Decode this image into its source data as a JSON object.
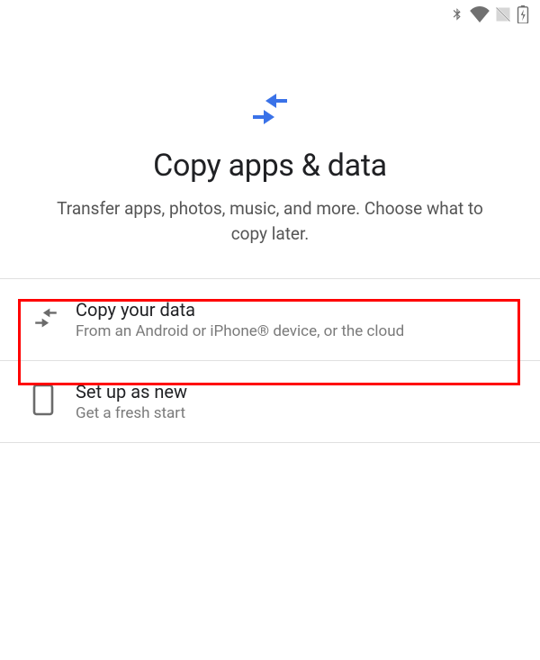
{
  "status": {
    "bluetooth": true,
    "wifi": true,
    "signal_disabled": true,
    "battery_charging": true
  },
  "header": {
    "title": "Copy apps & data",
    "subtitle": "Transfer apps, photos, music, and more. Choose what to copy later."
  },
  "options": {
    "copy": {
      "title": "Copy your data",
      "subtitle": "From an Android or iPhone® device, or the cloud"
    },
    "new": {
      "title": "Set up as new",
      "subtitle": "Get a fresh start"
    }
  },
  "highlight": {
    "target": "copy"
  }
}
